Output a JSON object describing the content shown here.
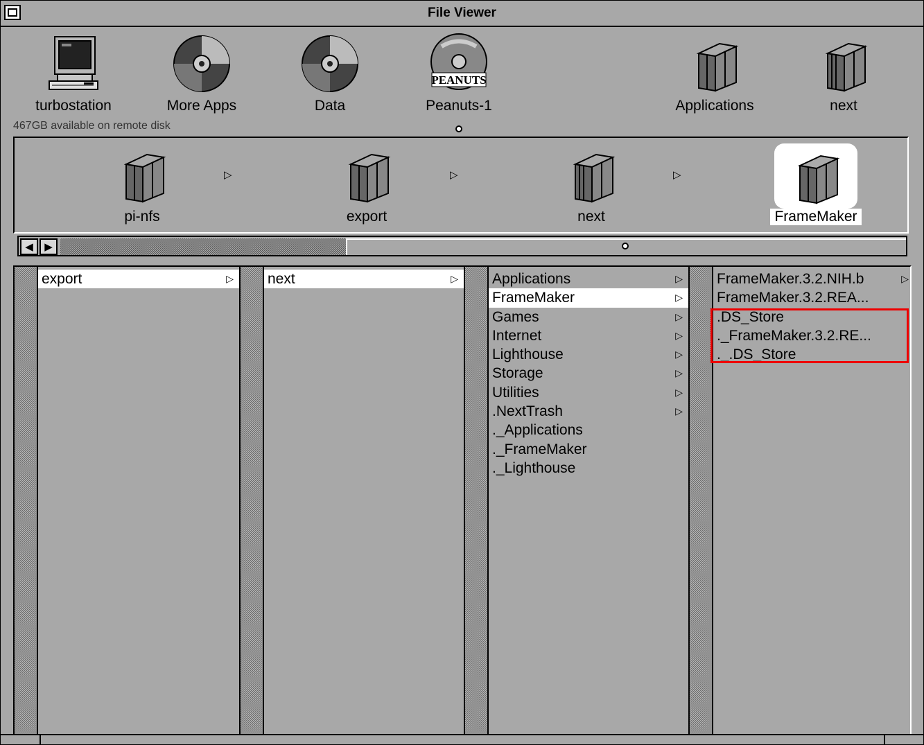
{
  "window": {
    "title": "File Viewer"
  },
  "shelf": {
    "items": [
      {
        "label": "turbostation",
        "icon": "computer-icon"
      },
      {
        "label": "More Apps",
        "icon": "cd-disk-icon"
      },
      {
        "label": "Data",
        "icon": "cd-disk-icon"
      },
      {
        "label": "Peanuts-1",
        "icon": "peanuts-disk-icon",
        "icon_text": "PEANUTS"
      },
      {
        "label": "Applications",
        "icon": "folder-icon"
      },
      {
        "label": "next",
        "icon": "folder-icon"
      }
    ],
    "disk_status": "467GB available on remote disk"
  },
  "path": {
    "items": [
      {
        "label": "pi-nfs",
        "icon": "folder-icon",
        "selected": false
      },
      {
        "label": "export",
        "icon": "folder-icon",
        "selected": false
      },
      {
        "label": "next",
        "icon": "folder-icon",
        "selected": false
      },
      {
        "label": "FrameMaker",
        "icon": "folder-icon",
        "selected": true
      }
    ]
  },
  "browser": {
    "columns": [
      {
        "rows": [
          {
            "label": "export",
            "folder": true,
            "selected": true
          }
        ]
      },
      {
        "rows": [
          {
            "label": "next",
            "folder": true,
            "selected": true
          }
        ]
      },
      {
        "rows": [
          {
            "label": "Applications",
            "folder": true,
            "selected": false
          },
          {
            "label": "FrameMaker",
            "folder": true,
            "selected": true
          },
          {
            "label": "Games",
            "folder": true,
            "selected": false
          },
          {
            "label": "Internet",
            "folder": true,
            "selected": false
          },
          {
            "label": "Lighthouse",
            "folder": true,
            "selected": false
          },
          {
            "label": "Storage",
            "folder": true,
            "selected": false
          },
          {
            "label": "Utilities",
            "folder": true,
            "selected": false
          },
          {
            "label": ".NextTrash",
            "folder": true,
            "selected": false
          },
          {
            "label": "._Applications",
            "folder": false,
            "selected": false
          },
          {
            "label": "._FrameMaker",
            "folder": false,
            "selected": false
          },
          {
            "label": "._Lighthouse",
            "folder": false,
            "selected": false
          }
        ]
      },
      {
        "rows": [
          {
            "label": "FrameMaker.3.2.NIH.b",
            "folder": true,
            "selected": false
          },
          {
            "label": "FrameMaker.3.2.REA...",
            "folder": false,
            "selected": false
          },
          {
            "label": ".DS_Store",
            "folder": false,
            "selected": false
          },
          {
            "label": "._FrameMaker.3.2.RE...",
            "folder": false,
            "selected": false
          },
          {
            "label": "._.DS_Store",
            "folder": false,
            "selected": false
          }
        ]
      }
    ],
    "arrow_glyph": "▷"
  },
  "colors": {
    "background": "#a8a8a8",
    "selection": "#ffffff",
    "highlight_box": "#e00000"
  }
}
